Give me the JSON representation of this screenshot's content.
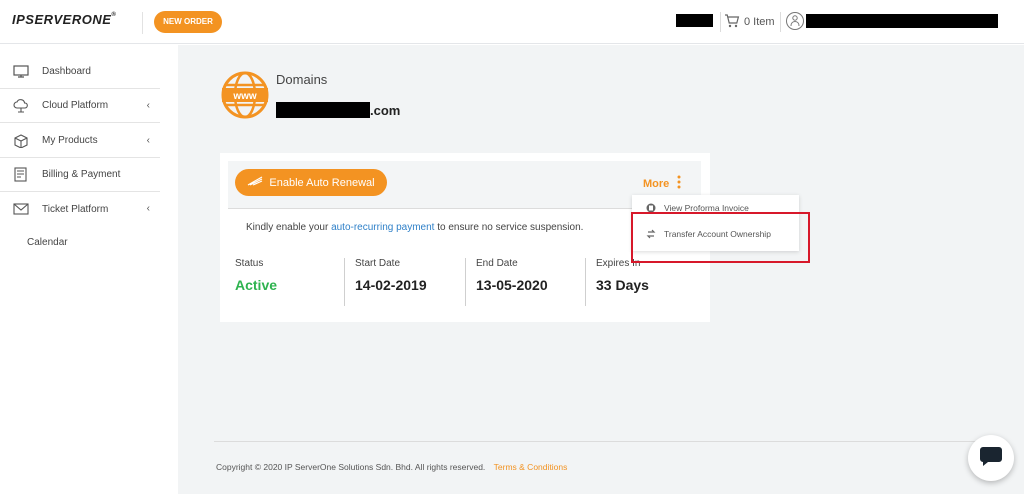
{
  "header": {
    "logo_text": "IPSERVERONE",
    "logo_mark": "®",
    "new_order_label": "NEW ORDER",
    "cart_label": "0 Item"
  },
  "sidebar": {
    "items": [
      {
        "label": "Dashboard",
        "icon": "monitor-icon",
        "has_submenu": false
      },
      {
        "label": "Cloud Platform",
        "icon": "cloud-icon",
        "has_submenu": true
      },
      {
        "label": "My Products",
        "icon": "box-icon",
        "has_submenu": true
      },
      {
        "label": "Billing & Payment",
        "icon": "invoice-icon",
        "has_submenu": false
      },
      {
        "label": "Ticket Platform",
        "icon": "envelope-icon",
        "has_submenu": true
      }
    ],
    "calendar_label": "Calendar"
  },
  "domain": {
    "title": "Domains",
    "tld": ".com",
    "globe_text": "www"
  },
  "card": {
    "renew_label": "Enable Auto Renewal",
    "more_label": "More",
    "notice_prefix": "Kindly enable your",
    "notice_link": "auto-recurring payment",
    "notice_suffix": "to ensure no service suspension.",
    "stats": [
      {
        "label": "Status",
        "value": "Active"
      },
      {
        "label": "Start Date",
        "value": "14-02-2019"
      },
      {
        "label": "End Date",
        "value": "13-05-2020"
      },
      {
        "label": "Expires In",
        "value": "33 Days"
      }
    ]
  },
  "dropdown": {
    "items": [
      {
        "label": "View Proforma Invoice",
        "icon": "invoice-circle-icon"
      },
      {
        "label": "Transfer Account Ownership",
        "icon": "transfer-arrows-icon"
      }
    ]
  },
  "footer": {
    "copyright": "Copyright © 2020 IP ServerOne Solutions Sdn. Bhd. All rights reserved.",
    "terms_label": "Terms & Conditions"
  },
  "colors": {
    "accent": "#f39322",
    "active": "#2eb34f",
    "link": "#2f80c8",
    "highlight": "#d7182a"
  }
}
